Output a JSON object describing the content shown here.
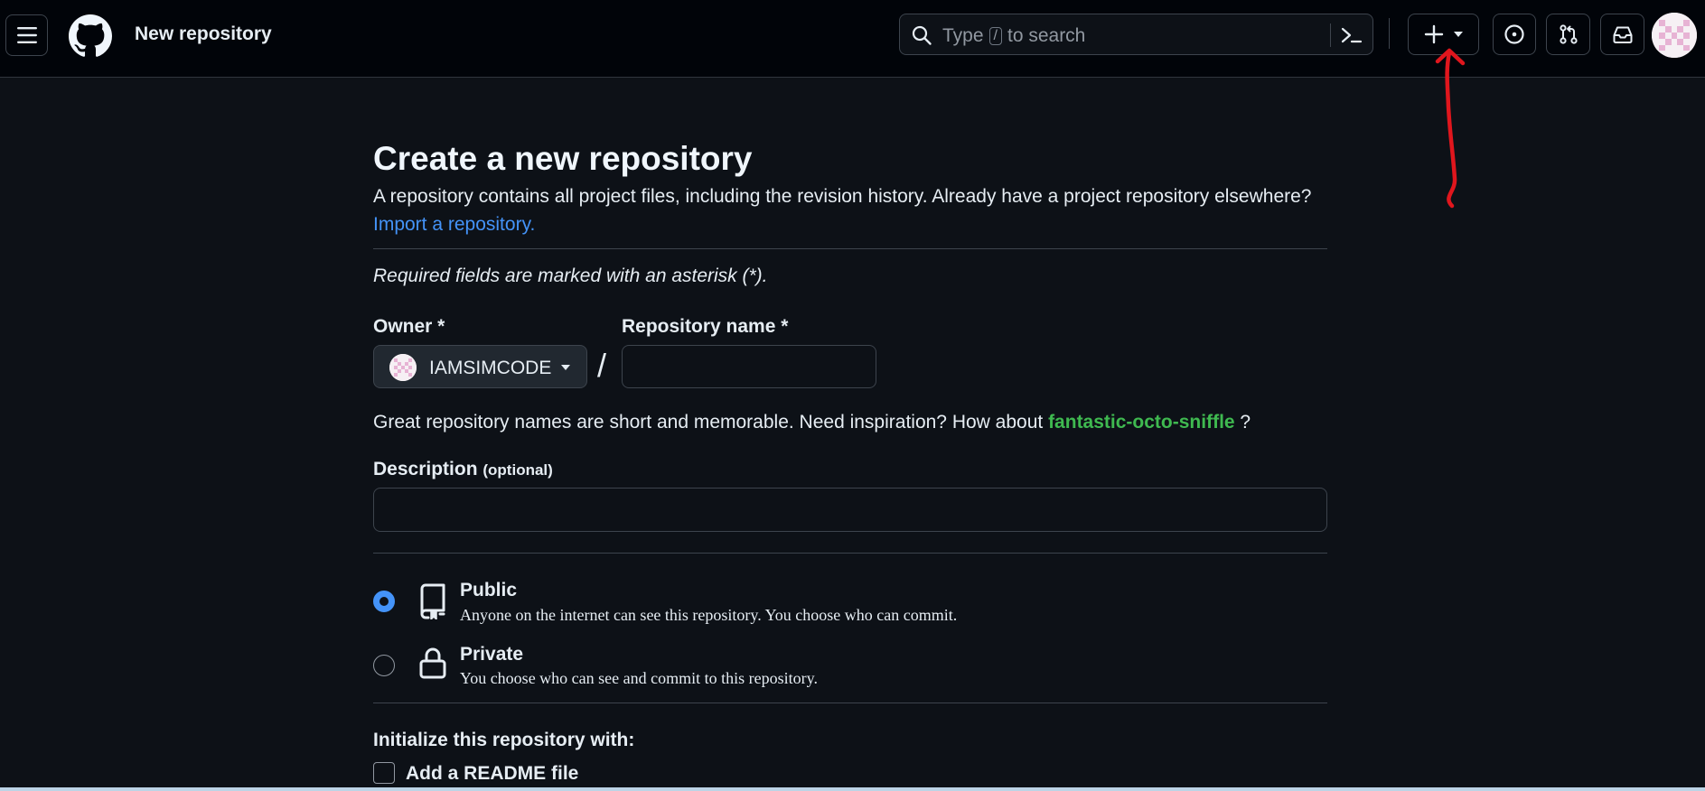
{
  "header": {
    "context_title": "New repository",
    "search": {
      "placeholder_prefix": "Type",
      "shortcut_key": "/",
      "placeholder_suffix": "to search"
    },
    "icons": {
      "menu": "hamburger-icon",
      "logo": "github-logo",
      "search": "search-icon",
      "command": "command-palette-icon",
      "create": "plus-icon",
      "caret": "triangle-down-icon",
      "issues": "issue-opened-icon",
      "pulls": "git-pull-request-icon",
      "inbox": "inbox-icon"
    }
  },
  "page": {
    "title": "Create a new repository",
    "lede": "A repository contains all project files, including the revision history. Already have a project repository elsewhere?",
    "import_link": "Import a repository.",
    "required_note": "Required fields are marked with an asterisk (*).",
    "owner_label": "Owner *",
    "owner_value": "IAMSIMCODE",
    "separator": "/",
    "repo_name_label": "Repository name *",
    "repo_name_value": "",
    "hint_prefix": "Great repository names are short and memorable. Need inspiration? How about",
    "hint_suggestion": "fantastic-octo-sniffle",
    "hint_suffix": "?",
    "description_label": "Description",
    "description_optional": "(optional)",
    "description_value": "",
    "visibility": {
      "public_title": "Public",
      "public_desc": "Anyone on the internet can see this repository. You choose who can commit.",
      "private_title": "Private",
      "private_desc": "You choose who can see and commit to this repository.",
      "selected": "public"
    },
    "init_label": "Initialize this repository with:",
    "readme_label": "Add a README file"
  },
  "colors": {
    "background": "#0d1117",
    "header": "#010409",
    "link": "#4493f8",
    "suggestion": "#3fb950",
    "annotation": "#e0161d"
  }
}
